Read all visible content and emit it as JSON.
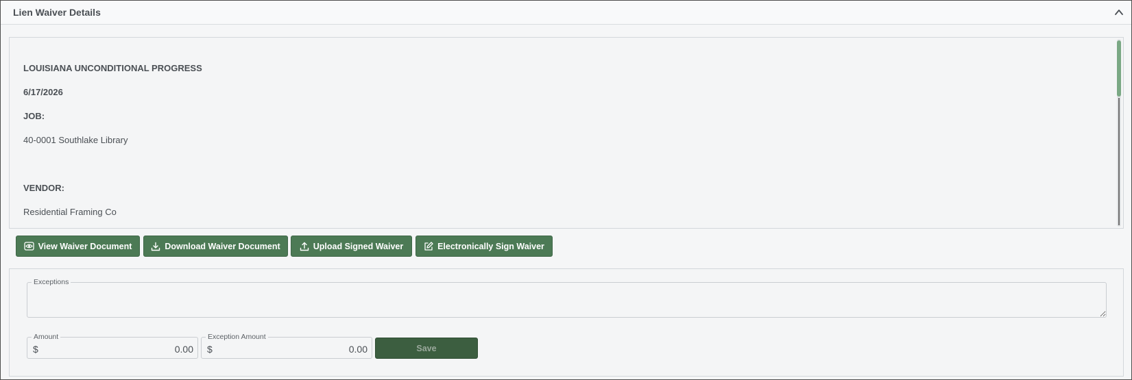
{
  "header": {
    "title": "Lien Waiver Details"
  },
  "document": {
    "lines": [
      {
        "text": "LOUISIANA UNCONDITIONAL PROGRESS",
        "bold": true
      },
      {
        "text": "6/17/2026",
        "bold": true
      },
      {
        "text": "JOB:",
        "bold": true
      },
      {
        "text": "40-0001 Southlake Library",
        "bold": false
      },
      {
        "text": "VENDOR:",
        "bold": true
      },
      {
        "text": "Residential Framing Co",
        "bold": false
      }
    ]
  },
  "actions": {
    "view_label": "View Waiver Document",
    "download_label": "Download Waiver Document",
    "upload_label": "Upload Signed Waiver",
    "esign_label": "Electronically Sign Waiver"
  },
  "form": {
    "exceptions_label": "Exceptions",
    "exceptions_value": "",
    "amount_label": "Amount",
    "amount_currency": "$",
    "amount_value": "0.00",
    "exception_amount_label": "Exception Amount",
    "exception_amount_currency": "$",
    "exception_amount_value": "0.00",
    "save_label": "Save"
  },
  "colors": {
    "button_green": "#4c7a55",
    "save_green": "#3c5e40",
    "panel_background": "#f5f6f7"
  }
}
